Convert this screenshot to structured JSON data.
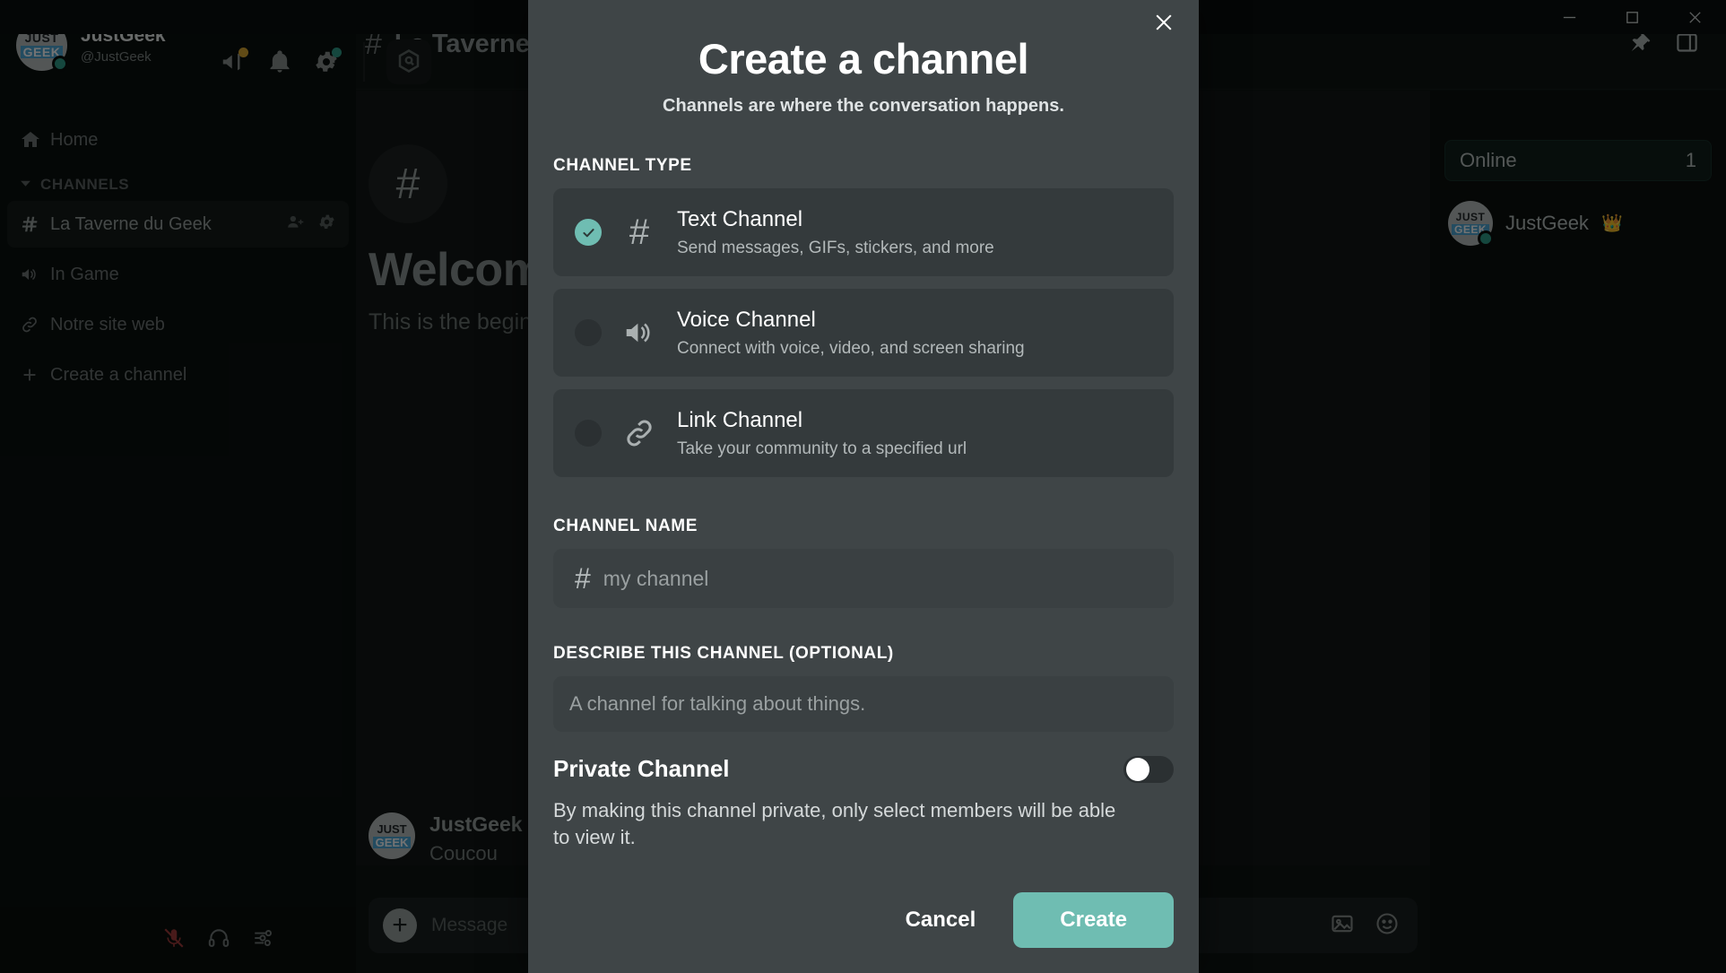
{
  "window": {
    "minimize_label": "minimize-icon",
    "maximize_label": "maximize-icon",
    "close_label": "close-icon"
  },
  "sidebar": {
    "profile": {
      "name": "JustGeek",
      "handle": "@JustGeek",
      "avatar_top": "JUST",
      "avatar_bottom": "GEEK"
    },
    "top_icons": [
      {
        "name": "announcement-icon",
        "badge_color": "#d8a732"
      },
      {
        "name": "bell-icon",
        "badge_color": ""
      },
      {
        "name": "gear-icon",
        "badge_color": "#2f9d8a"
      }
    ],
    "home_label": "Home",
    "section_label": "CHANNELS",
    "channels": [
      {
        "label": "La Taverne du Geek",
        "icon": "hash-icon",
        "active": true
      },
      {
        "label": "In Game",
        "icon": "speaker-icon",
        "active": false
      },
      {
        "label": "Notre site web",
        "icon": "link-icon",
        "active": false
      }
    ],
    "create_channel_label": "Create a channel",
    "voice_bar": [
      {
        "name": "microphone-muted-icon"
      },
      {
        "name": "headphones-icon"
      },
      {
        "name": "audio-settings-icon"
      }
    ]
  },
  "main": {
    "channel_header": {
      "hash": "#",
      "title": "La Taverne du Geek",
      "pin_icon": "pin-icon",
      "panel_icon": "members-panel-icon"
    },
    "welcome": {
      "hash": "#",
      "title": "Welcome",
      "subtitle": "This is the beginning"
    },
    "message": {
      "author": "JustGeek",
      "text": "Coucou",
      "avatar_top": "JUST",
      "avatar_bottom": "GEEK"
    },
    "composer": {
      "plus": "+",
      "placeholder": "Message",
      "image_icon": "image-icon",
      "emoji_icon": "emoji-icon"
    }
  },
  "members": {
    "online_label": "Online",
    "online_count": "1",
    "list": [
      {
        "name": "JustGeek",
        "badge": "👑",
        "avatar_top": "JUST",
        "avatar_bottom": "GEEK"
      }
    ]
  },
  "modal": {
    "title": "Create a channel",
    "subtitle": "Channels are where the conversation happens.",
    "close_icon": "close-icon",
    "channel_type_label": "CHANNEL TYPE",
    "channel_types": [
      {
        "title": "Text Channel",
        "desc": "Send messages, GIFs, stickers, and more",
        "icon": "hash-icon",
        "selected": true
      },
      {
        "title": "Voice Channel",
        "desc": "Connect with voice, video, and screen sharing",
        "icon": "speaker-icon",
        "selected": false
      },
      {
        "title": "Link Channel",
        "desc": "Take your community to a specified url",
        "icon": "link-icon",
        "selected": false
      }
    ],
    "channel_name_label": "CHANNEL NAME",
    "channel_name_hash": "#",
    "channel_name_value": "",
    "channel_name_placeholder": "my channel",
    "describe_label": "DESCRIBE THIS CHANNEL (OPTIONAL)",
    "describe_value": "",
    "describe_placeholder": "A channel for talking about things.",
    "private_title": "Private Channel",
    "private_desc": "By making this channel private, only select members will be able to view it.",
    "private_enabled": false,
    "cancel_label": "Cancel",
    "create_label": "Create",
    "accent_color": "#6fbdb2"
  }
}
